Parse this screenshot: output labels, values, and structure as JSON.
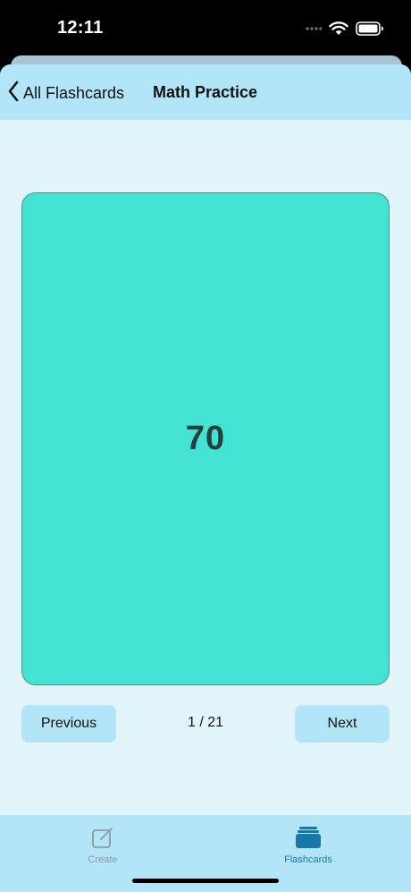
{
  "status_bar": {
    "time": "12:11",
    "icons": [
      "signal-icon",
      "wifi-icon",
      "battery-icon"
    ]
  },
  "nav": {
    "back_label": "All Flashcards",
    "back_icon": "chevron-left-icon",
    "title": "Math Practice"
  },
  "card": {
    "text": "70",
    "color": "#44e2d2"
  },
  "pager": {
    "previous_label": "Previous",
    "next_label": "Next",
    "counter": "1 / 21"
  },
  "tab_bar": {
    "tabs": [
      {
        "label": "Create",
        "icon": "compose-icon",
        "selected": false
      },
      {
        "label": "Flashcards",
        "icon": "card-stack-icon",
        "selected": true
      }
    ]
  },
  "colors": {
    "nav_background": "#b3e5f8",
    "content_background": "#e1f5fb",
    "accent": "#1a78a6"
  }
}
